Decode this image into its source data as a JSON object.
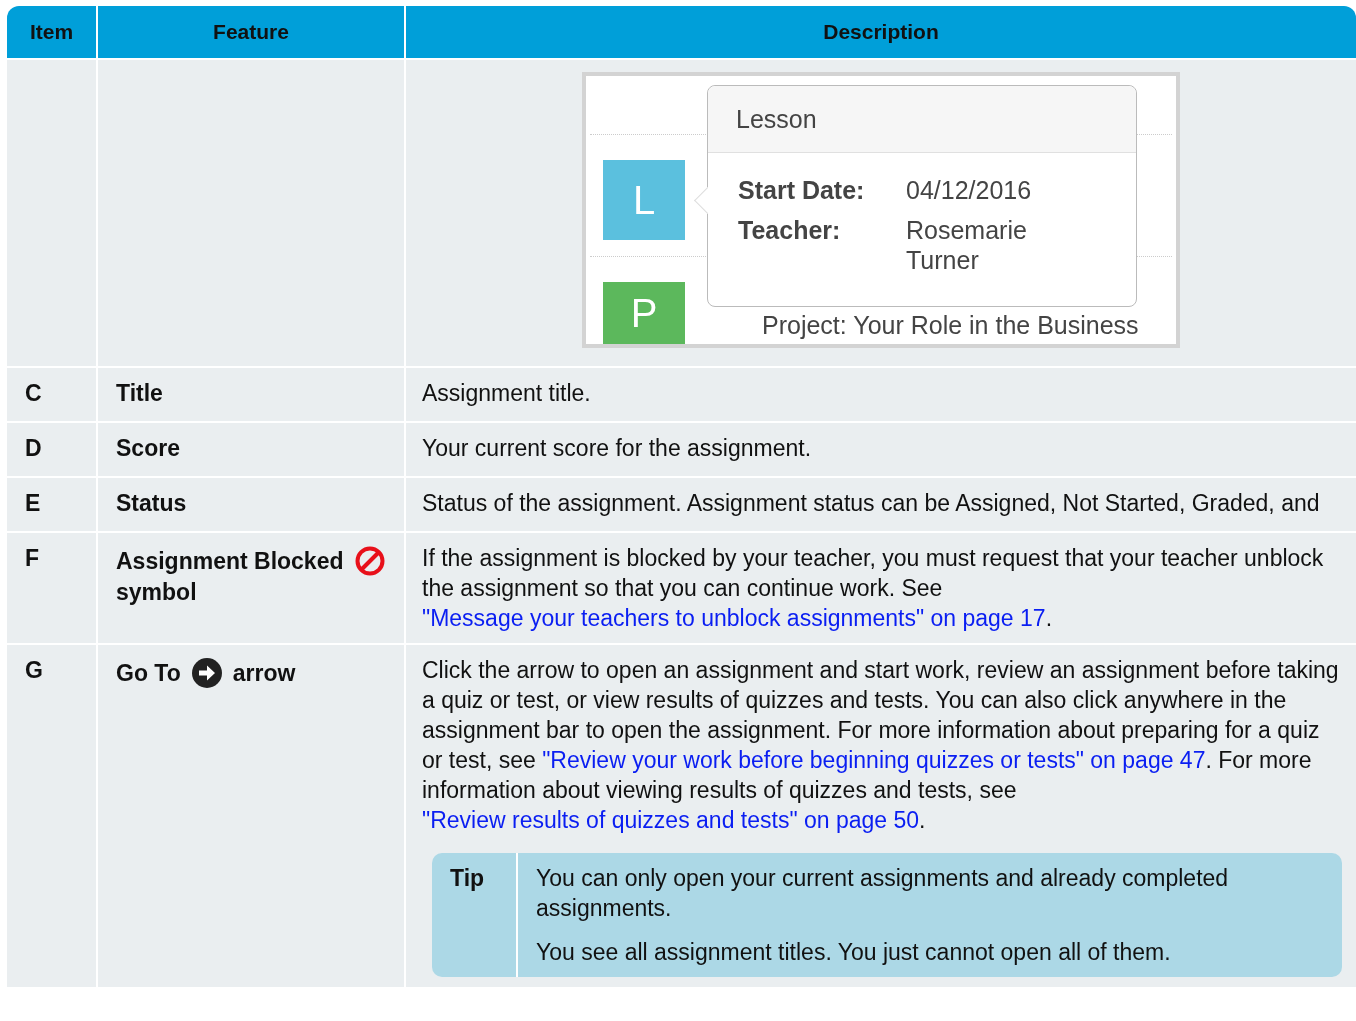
{
  "table": {
    "columns": [
      "Item",
      "Feature",
      "Description"
    ],
    "preview": {
      "badges": [
        {
          "letter": "L",
          "color": "#5bc0de"
        },
        {
          "letter": "P",
          "color": "#5cb85c"
        }
      ],
      "row_title": "Project: Your Role in the Business",
      "tooltip": {
        "title": "Lesson",
        "fields": [
          {
            "label": "Start Date:",
            "value": "04/12/2016"
          },
          {
            "label": "Teacher:",
            "value": "Rosemarie Turner"
          }
        ]
      }
    },
    "rows": [
      {
        "item": "C",
        "feature": [
          {
            "kind": "text",
            "text": "Title"
          }
        ],
        "description": [
          [
            {
              "kind": "text",
              "text": "Assignment title."
            }
          ]
        ]
      },
      {
        "item": "D",
        "feature": [
          {
            "kind": "text",
            "text": "Score"
          }
        ],
        "description": [
          [
            {
              "kind": "text",
              "text": "Your current score for the assignment."
            }
          ]
        ]
      },
      {
        "item": "E",
        "feature": [
          {
            "kind": "text",
            "text": "Status"
          }
        ],
        "description": [
          [
            {
              "kind": "text",
              "text": "Status of the assignment. Assignment status can be Assigned, Not Started, Graded, and"
            }
          ]
        ]
      },
      {
        "item": "F",
        "feature": [
          {
            "kind": "text",
            "text": "Assignment Blocked"
          },
          {
            "kind": "no-entry"
          },
          {
            "kind": "text",
            "text": "symbol"
          }
        ],
        "description": [
          [
            {
              "kind": "text",
              "text": "If the assignment is blocked by your teacher, you must request that your teacher unblock the assignment so that you can continue work. See "
            },
            {
              "kind": "link",
              "text": "\"Message your teachers to unblock assignments\" on page 17"
            },
            {
              "kind": "text",
              "text": "."
            }
          ]
        ]
      },
      {
        "item": "G",
        "feature": [
          {
            "kind": "text",
            "text": "Go To"
          },
          {
            "kind": "arrow-circle"
          },
          {
            "kind": "text",
            "text": "arrow"
          }
        ],
        "description": [
          [
            {
              "kind": "text",
              "text": "Click the arrow to open an assignment and start work, review an assignment before taking a quiz or test, or view results of quizzes and tests. You can also click anywhere in the assignment bar to open the assignment. For more information about preparing for a quiz or test, see "
            },
            {
              "kind": "link",
              "text": "\"Review your work before beginning quizzes or tests\" on page 47"
            },
            {
              "kind": "text",
              "text": ". For more information about viewing results of quizzes and tests, see "
            },
            {
              "kind": "link",
              "text": "\"Review results of quizzes and tests\" on page 50"
            },
            {
              "kind": "text",
              "text": "."
            }
          ]
        ],
        "tip": {
          "label": "Tip",
          "paragraphs": [
            "You can only open your current assignments and already completed assignments.",
            "You see all assignment titles. You just cannot open all of them."
          ]
        }
      }
    ]
  }
}
